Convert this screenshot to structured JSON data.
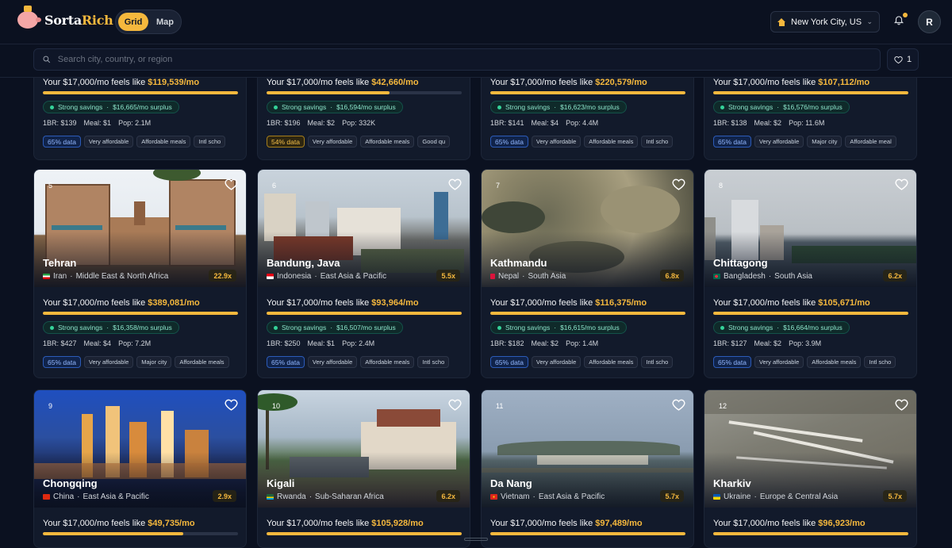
{
  "brand": {
    "name_part1": "Sorta",
    "name_part2": "Rich"
  },
  "view_toggle": {
    "grid": "Grid",
    "map": "Map",
    "active": "grid"
  },
  "location": {
    "label": "New York City, US"
  },
  "user": {
    "initial": "R"
  },
  "search": {
    "placeholder": "Search city, country, or region"
  },
  "favorites": {
    "count": "1"
  },
  "salary_phrase": "Your $17,000/mo feels like",
  "labels": {
    "strong_savings": "Strong savings",
    "surplus_suffix": "/mo surplus",
    "rent_prefix": "1BR:",
    "meal_prefix": "Meal:",
    "pop_prefix": "Pop:"
  },
  "colors": {
    "accent": "#f5b83d",
    "savings": "#34d399",
    "data_tag": "#2c5bb8",
    "background": "#0b1120"
  },
  "cards": [
    {
      "rank": "",
      "city": "",
      "country": "",
      "region": "",
      "multiplier": "",
      "feels_like": "$119,539/mo",
      "surplus": "$16,665/mo surplus",
      "rent": "1BR: $139",
      "meal": "Meal: $1",
      "pop": "Pop: 2.1M",
      "data": "65% data",
      "tags": [
        "Very affordable",
        "Affordable meals",
        "Intl scho"
      ],
      "bar_fill": 1.0
    },
    {
      "rank": "",
      "city": "",
      "country": "",
      "region": "",
      "multiplier": "",
      "feels_like": "$42,660/mo",
      "surplus": "$16,594/mo surplus",
      "rent": "1BR: $196",
      "meal": "Meal: $2",
      "pop": "Pop: 332K",
      "data": "54% data",
      "tags": [
        "Very affordable",
        "Affordable meals",
        "Good qu"
      ],
      "bar_fill": 0.63
    },
    {
      "rank": "",
      "city": "",
      "country": "",
      "region": "",
      "multiplier": "",
      "feels_like": "$220,579/mo",
      "surplus": "$16,623/mo surplus",
      "rent": "1BR: $141",
      "meal": "Meal: $4",
      "pop": "Pop: 4.4M",
      "data": "65% data",
      "tags": [
        "Very affordable",
        "Affordable meals",
        "Intl scho"
      ],
      "bar_fill": 1.0
    },
    {
      "rank": "",
      "city": "",
      "country": "",
      "region": "",
      "multiplier": "",
      "feels_like": "$107,112/mo",
      "surplus": "$16,576/mo surplus",
      "rent": "1BR: $138",
      "meal": "Meal: $2",
      "pop": "Pop: 11.6M",
      "data": "65% data",
      "tags": [
        "Very affordable",
        "Major city",
        "Affordable meal"
      ],
      "bar_fill": 1.0
    },
    {
      "rank": "5",
      "city": "Tehran",
      "country": "Iran",
      "region": "Middle East & North Africa",
      "multiplier": "22.9x",
      "feels_like": "$389,081/mo",
      "surplus": "$16,358/mo surplus",
      "rent": "1BR: $427",
      "meal": "Meal: $4",
      "pop": "Pop: 7.2M",
      "data": "65% data",
      "tags": [
        "Very affordable",
        "Major city",
        "Affordable meals"
      ],
      "bar_fill": 1.0
    },
    {
      "rank": "6",
      "city": "Bandung, Java",
      "country": "Indonesia",
      "region": "East Asia & Pacific",
      "multiplier": "5.5x",
      "feels_like": "$93,964/mo",
      "surplus": "$16,507/mo surplus",
      "rent": "1BR: $250",
      "meal": "Meal: $1",
      "pop": "Pop: 2.4M",
      "data": "65% data",
      "tags": [
        "Very affordable",
        "Affordable meals",
        "Intl scho"
      ],
      "bar_fill": 1.0
    },
    {
      "rank": "7",
      "city": "Kathmandu",
      "country": "Nepal",
      "region": "South Asia",
      "multiplier": "6.8x",
      "feels_like": "$116,375/mo",
      "surplus": "$16,615/mo surplus",
      "rent": "1BR: $182",
      "meal": "Meal: $2",
      "pop": "Pop: 1.4M",
      "data": "65% data",
      "tags": [
        "Very affordable",
        "Affordable meals",
        "Intl scho"
      ],
      "bar_fill": 1.0
    },
    {
      "rank": "8",
      "city": "Chittagong",
      "country": "Bangladesh",
      "region": "South Asia",
      "multiplier": "6.2x",
      "feels_like": "$105,671/mo",
      "surplus": "$16,664/mo surplus",
      "rent": "1BR: $127",
      "meal": "Meal: $2",
      "pop": "Pop: 3.9M",
      "data": "65% data",
      "tags": [
        "Very affordable",
        "Affordable meals",
        "Intl scho"
      ],
      "bar_fill": 1.0
    },
    {
      "rank": "9",
      "city": "Chongqing",
      "country": "China",
      "region": "East Asia & Pacific",
      "multiplier": "2.9x",
      "feels_like": "$49,735/mo",
      "surplus": "",
      "rent": "",
      "meal": "",
      "pop": "",
      "data": "",
      "tags": [],
      "bar_fill": 0.72
    },
    {
      "rank": "10",
      "city": "Kigali",
      "country": "Rwanda",
      "region": "Sub-Saharan Africa",
      "multiplier": "6.2x",
      "feels_like": "$105,928/mo",
      "surplus": "",
      "rent": "",
      "meal": "",
      "pop": "",
      "data": "",
      "tags": [],
      "bar_fill": 1.0
    },
    {
      "rank": "11",
      "city": "Da Nang",
      "country": "Vietnam",
      "region": "East Asia & Pacific",
      "multiplier": "5.7x",
      "feels_like": "$97,489/mo",
      "surplus": "",
      "rent": "",
      "meal": "",
      "pop": "",
      "data": "",
      "tags": [],
      "bar_fill": 1.0
    },
    {
      "rank": "12",
      "city": "Kharkiv",
      "country": "Ukraine",
      "region": "Europe & Central Asia",
      "multiplier": "5.7x",
      "feels_like": "$96,923/mo",
      "surplus": "",
      "rent": "",
      "meal": "",
      "pop": "",
      "data": "",
      "tags": [],
      "bar_fill": 1.0
    }
  ]
}
